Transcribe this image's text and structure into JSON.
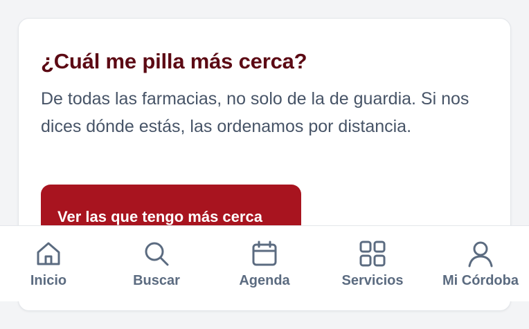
{
  "card": {
    "title": "¿Cuál me pilla más cerca?",
    "text": "De todas las farmacias, no solo de la de guardia. Si nos dices dónde estás, las ordenamos por distancia.",
    "button_label": "Ver las que tengo más cerca"
  },
  "tabbar": {
    "items": [
      {
        "label": "Inicio",
        "icon": "home-icon"
      },
      {
        "label": "Buscar",
        "icon": "search-icon"
      },
      {
        "label": "Agenda",
        "icon": "calendar-icon"
      },
      {
        "label": "Servicios",
        "icon": "grid-icon"
      },
      {
        "label": "Mi Córdoba",
        "icon": "user-icon"
      }
    ]
  },
  "colors": {
    "title": "#5c0a14",
    "button": "#a8141f",
    "tab_label": "#5b6b80"
  }
}
